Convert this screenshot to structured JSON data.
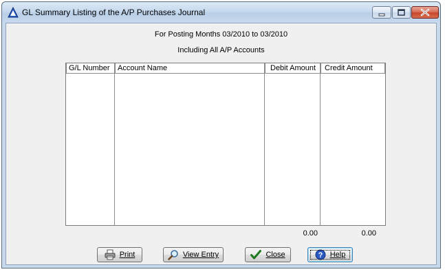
{
  "window": {
    "title": "GL Summary Listing of the A/P Purchases Journal"
  },
  "report": {
    "subtitle_line1": "For Posting Months 03/2010 to 03/2010",
    "subtitle_line2": "Including All A/P Accounts"
  },
  "table": {
    "columns": [
      "G/L Number",
      "Account Name",
      "Debit Amount",
      "Credit Amount"
    ],
    "rows": []
  },
  "totals": {
    "debit": "0.00",
    "credit": "0.00"
  },
  "buttons": {
    "print": "Print",
    "view_entry": "View Entry",
    "close": "Close",
    "help": "Help"
  }
}
